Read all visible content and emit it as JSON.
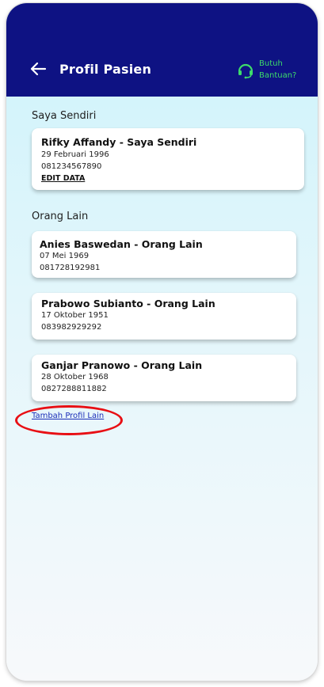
{
  "header": {
    "title": "Profil Pasien",
    "help_line1": "Butuh",
    "help_line2": "Bantuan?"
  },
  "self_section": {
    "label": "Saya Sendiri",
    "profile": {
      "name": "Rifky Affandy - Saya Sendiri",
      "birth_date": "29 Februari 1996",
      "phone": "081234567890",
      "edit_label": "EDIT DATA"
    }
  },
  "others_section": {
    "label": "Orang Lain",
    "profiles": [
      {
        "name": "Anies Baswedan - Orang Lain",
        "birth_date": "07 Mei 1969",
        "phone": "081728192981"
      },
      {
        "name": "Prabowo Subianto - Orang Lain",
        "birth_date": "17 Oktober 1951",
        "phone": "083982929292"
      },
      {
        "name": "Ganjar Pranowo - Orang Lain",
        "birth_date": "28 Oktober 1968",
        "phone": "0827288811882"
      }
    ]
  },
  "add_profile_label": "Tambah Profil Lain",
  "colors": {
    "header_bg": "#0e1283",
    "help_accent": "#3ddc6a",
    "link": "#1a2db8",
    "highlight": "#e80f14"
  }
}
